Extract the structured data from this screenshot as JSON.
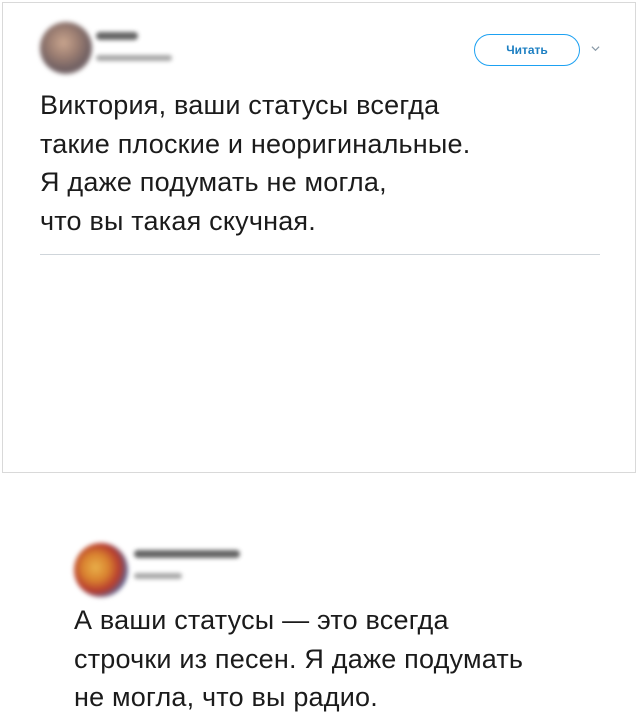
{
  "tweet_1": {
    "follow_label": "Читать",
    "text_lines": [
      "Виктория, ваши статусы всегда",
      "такие плоские и неоригинальные.",
      "Я даже подумать не могла,",
      "что вы такая скучная."
    ]
  },
  "tweet_2": {
    "text_lines": [
      "А ваши статусы — это всегда",
      "строчки из песен. Я даже подумать",
      "не могла, что вы радио."
    ]
  },
  "colors": {
    "accent": "#1da1f2",
    "text": "#1b1b1b",
    "divider": "#cfd5da"
  },
  "icons": [
    "avatar",
    "chevron-down-icon"
  ]
}
